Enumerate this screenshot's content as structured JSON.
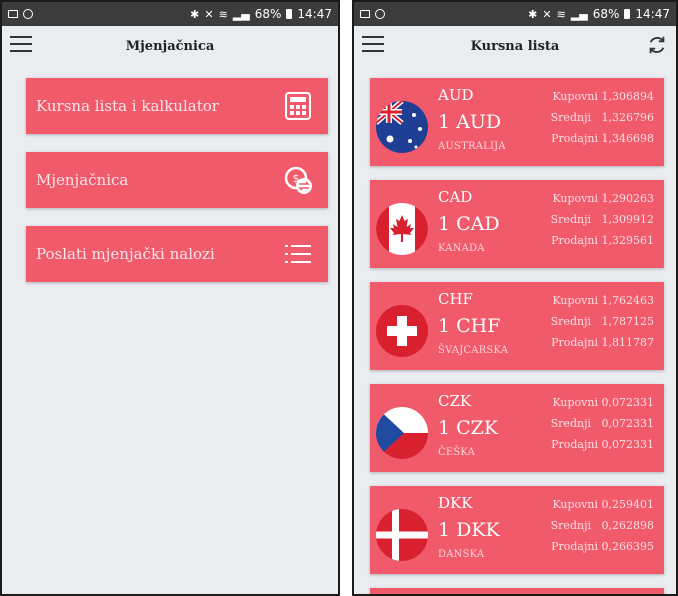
{
  "status_bar": {
    "battery": "68%",
    "time": "14:47"
  },
  "left_screen": {
    "title": "Mjenjačnica",
    "menu_items": [
      {
        "label": "Kursna lista i kalkulator",
        "icon": "calculator-icon"
      },
      {
        "label": "Mjenjačnica",
        "icon": "currency-exchange-icon"
      },
      {
        "label": "Poslati mjenjački nalozi",
        "icon": "list-icon"
      }
    ]
  },
  "right_screen": {
    "title": "Kursna lista",
    "labels": {
      "buy": "Kupovni",
      "mid": "Srednji",
      "sell": "Prodajni"
    },
    "currencies": [
      {
        "code": "AUD",
        "amount": "1 AUD",
        "country": "AUSTRALIJA",
        "buy": "1,306894",
        "mid": "1,326796",
        "sell": "1,346698",
        "flag": "australia-flag-icon"
      },
      {
        "code": "CAD",
        "amount": "1 CAD",
        "country": "KANADA",
        "buy": "1,290263",
        "mid": "1,309912",
        "sell": "1,329561",
        "flag": "canada-flag-icon"
      },
      {
        "code": "CHF",
        "amount": "1 CHF",
        "country": "ŠVAJCARSKA",
        "buy": "1,762463",
        "mid": "1,787125",
        "sell": "1,811787",
        "flag": "switzerland-flag-icon"
      },
      {
        "code": "CZK",
        "amount": "1 CZK",
        "country": "ČEŠKA",
        "buy": "0,072331",
        "mid": "0,072331",
        "sell": "0,072331",
        "flag": "czech-flag-icon"
      },
      {
        "code": "DKK",
        "amount": "1 DKK",
        "country": "DANSKA",
        "buy": "0,259401",
        "mid": "0,262898",
        "sell": "0,266395",
        "flag": "denmark-flag-icon"
      }
    ]
  },
  "colors": {
    "accent": "#f05a6a",
    "background": "#e9edf0",
    "statusbar": "#3c3c3c"
  }
}
